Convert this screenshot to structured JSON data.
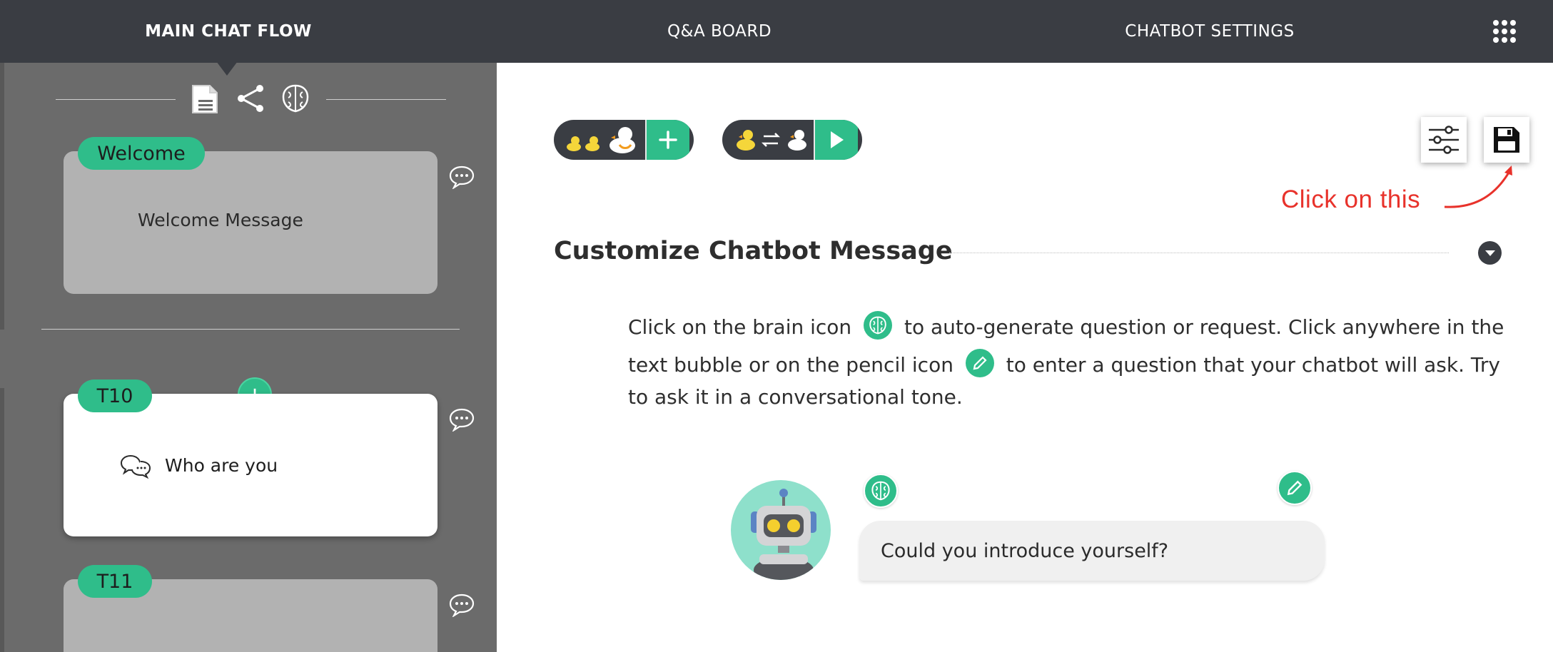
{
  "nav": {
    "tabs": [
      {
        "label": "MAIN CHAT FLOW",
        "active": true
      },
      {
        "label": "Q&A BOARD",
        "active": false
      },
      {
        "label": "CHATBOT SETTINGS",
        "active": false
      }
    ],
    "apps_icon": "grid-menu-icon"
  },
  "sidebar": {
    "toolbar_icons": [
      "document-icon",
      "share-icon",
      "brain-icon"
    ],
    "cards": [
      {
        "tag": "Welcome",
        "text": "Welcome Message",
        "selected": false
      },
      {
        "tag": "T10",
        "text": "Who are you",
        "selected": true
      },
      {
        "tag": "T11",
        "text": "",
        "selected": false
      }
    ],
    "add_label": "+"
  },
  "main": {
    "annotation": "Click on this",
    "section_title": "Customize Chatbot Message",
    "instructions": {
      "line1_a": "Click on the brain icon",
      "line1_b": "to auto-generate question or request. Click anywhere in the",
      "line2_a": "text bubble or on the pencil icon",
      "line2_b": "to enter a question that your chatbot will ask. Try",
      "line3": "to ask it in a conversational tone."
    },
    "chat_message": "Could you introduce yourself?"
  },
  "colors": {
    "accent": "#2fbd8a",
    "nav_bg": "#3a3d43",
    "sidebar_bg": "#6b6b6b",
    "annotation": "#e8322b"
  }
}
